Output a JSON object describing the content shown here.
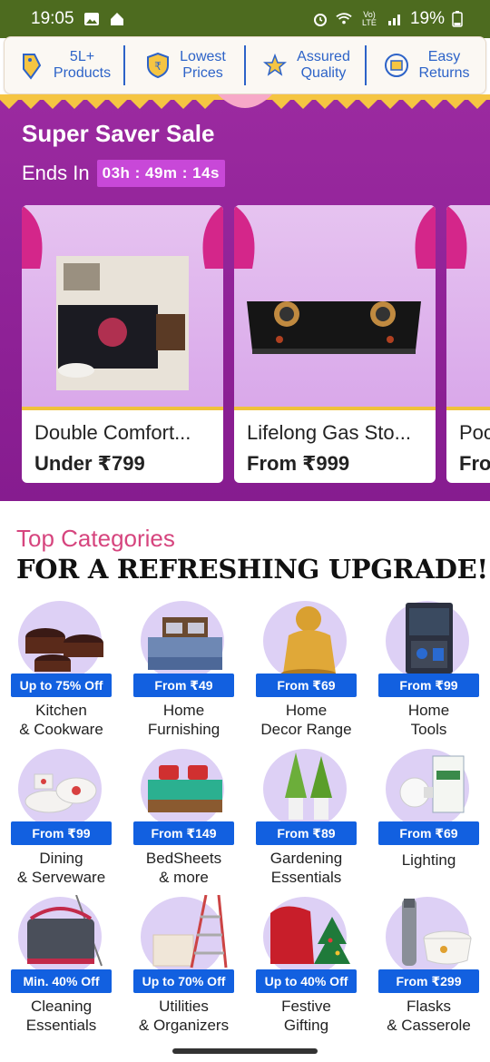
{
  "status_bar": {
    "time": "19:05",
    "network": "Vo) LTE",
    "battery": "19%"
  },
  "trust_strip": [
    {
      "line1": "5L+",
      "line2": "Products",
      "icon": "price-tag-icon"
    },
    {
      "line1": "Lowest",
      "line2": "Prices",
      "icon": "rupee-shield-icon"
    },
    {
      "line1": "Assured",
      "line2": "Quality",
      "icon": "star-icon"
    },
    {
      "line1": "Easy",
      "line2": "Returns",
      "icon": "return-box-icon"
    }
  ],
  "sale": {
    "title": "Super Saver Sale",
    "ends_label": "Ends In",
    "timer": "03h : 49m : 14s",
    "cards": [
      {
        "name": "Double Comfort...",
        "price": "Under ₹799",
        "image": "comforter-bed-image"
      },
      {
        "name": "Lifelong Gas Sto...",
        "price": "From ₹999",
        "image": "gas-stove-image"
      },
      {
        "name": "Poc",
        "price": "Fro",
        "image": "partial-product-image"
      }
    ]
  },
  "categories": {
    "subtitle": "Top Categories",
    "heading": "FOR A REFRESHING UPGRADE!",
    "items": [
      {
        "badge": "Up to 75% Off",
        "label1": "Kitchen",
        "label2": "& Cookware",
        "image": "cookware-pots"
      },
      {
        "badge": "From ₹49",
        "label1": "Home",
        "label2": "Furnishing",
        "image": "bed-furnishing"
      },
      {
        "badge": "From ₹69",
        "label1": "Home",
        "label2": "Decor Range",
        "image": "buddha-statue"
      },
      {
        "badge": "From ₹99",
        "label1": "Home",
        "label2": "Tools",
        "image": "tool-kit"
      },
      {
        "badge": "From ₹99",
        "label1": "Dining",
        "label2": "& Serveware",
        "image": "dinner-set"
      },
      {
        "badge": "From ₹149",
        "label1": "BedSheets",
        "label2": "& more",
        "image": "bedsheet"
      },
      {
        "badge": "From ₹89",
        "label1": "Gardening",
        "label2": "Essentials",
        "image": "potted-plants"
      },
      {
        "badge": "From ₹69",
        "label1": "Lighting",
        "label2": "",
        "image": "led-bulb"
      },
      {
        "badge": "Min. 40% Off",
        "label1": "Cleaning",
        "label2": "Essentials",
        "image": "mop-bucket"
      },
      {
        "badge": "Up to 70% Off",
        "label1": "Utilities",
        "label2": "& Organizers",
        "image": "ladder-organizer"
      },
      {
        "badge": "Up to 40% Off",
        "label1": "Festive",
        "label2": "Gifting",
        "image": "christmas-gift"
      },
      {
        "badge": "From ₹299",
        "label1": "Flasks",
        "label2": "& Casserole",
        "image": "flask-casserole"
      }
    ]
  },
  "colors": {
    "status_bar": "#4d6b1f",
    "banner": "#8e2196",
    "badge": "#1260e0",
    "subtitle": "#d6457e",
    "trust_text": "#2d63c8"
  }
}
